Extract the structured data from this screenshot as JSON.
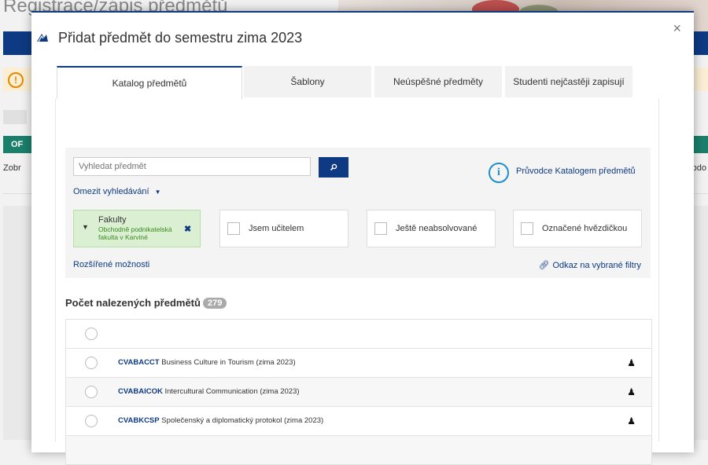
{
  "background": {
    "page_title": "Registrace/zápis předmětů",
    "green_bar_label": "OF",
    "left_text": "Zobr",
    "right_text": "obdo"
  },
  "modal": {
    "title": "Přidat předmět do semestru zima 2023",
    "close": "×"
  },
  "tabs": [
    {
      "label": "Katalog předmětů",
      "active": true
    },
    {
      "label": "Šablony",
      "active": false
    },
    {
      "label": "Neúspěšné předměty",
      "active": false
    },
    {
      "label": "Studenti nejčastěji zapisují",
      "active": false
    }
  ],
  "search": {
    "placeholder": "Vyhledat předmět",
    "button_icon": "search-icon",
    "narrow_label": "Omezit vyhledávání",
    "guide_label": "Průvodce Katalogem předmětů",
    "guide_icon_text": "i"
  },
  "filters": {
    "faculty": {
      "label": "Fakulty",
      "value": "Obchodně podnikatelská fakulta v Karviné"
    },
    "checkboxes": [
      {
        "label": "Jsem učitelem",
        "checked": false
      },
      {
        "label": "Ještě neabsolvované",
        "checked": false
      },
      {
        "label": "Označené hvězdičkou",
        "checked": false
      }
    ],
    "advanced": "Rozšířené možnosti",
    "link_label": "Odkaz na vybrané filtry"
  },
  "results": {
    "title": "Počet nalezených předmětů",
    "count": "279",
    "courses": [
      {
        "code": "CVABACCT",
        "name": "Business Culture in Tourism (zima 2023)"
      },
      {
        "code": "CVABAICOK",
        "name": "Intercultural Communication (zima 2023)"
      },
      {
        "code": "CVABKCSP",
        "name": "Společenský a diplomatický protokol (zima 2023)"
      }
    ]
  },
  "colors": {
    "primary": "#0e3a83",
    "faculty_bg": "#dbf0d2",
    "info": "#1b8fd0",
    "green_bar": "#1a7f6b"
  }
}
